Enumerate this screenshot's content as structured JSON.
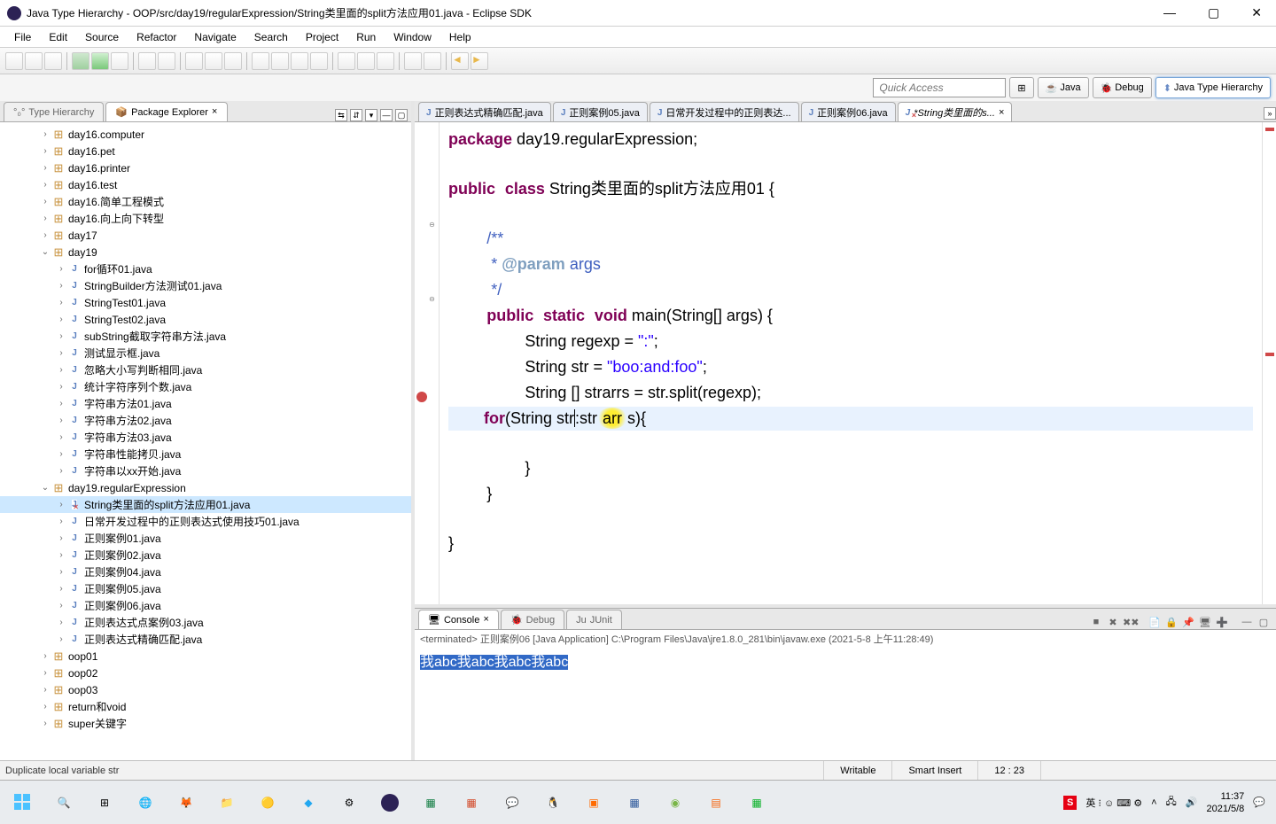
{
  "window": {
    "title": "Java Type Hierarchy - OOP/src/day19/regularExpression/String类里面的split方法应用01.java - Eclipse SDK"
  },
  "menu": [
    "File",
    "Edit",
    "Source",
    "Refactor",
    "Navigate",
    "Search",
    "Project",
    "Run",
    "Window",
    "Help"
  ],
  "quick_access_placeholder": "Quick Access",
  "perspectives": {
    "java": "Java",
    "debug": "Debug",
    "type_hierarchy": "Java Type Hierarchy"
  },
  "left_views": {
    "type_hierarchy": "Type Hierarchy",
    "package_explorer": "Package Explorer"
  },
  "tree": [
    {
      "l": 2,
      "t": "pkg",
      "exp": "›",
      "label": "day16.computer"
    },
    {
      "l": 2,
      "t": "pkg",
      "exp": "›",
      "label": "day16.pet"
    },
    {
      "l": 2,
      "t": "pkg",
      "exp": "›",
      "label": "day16.printer"
    },
    {
      "l": 2,
      "t": "pkg",
      "exp": "›",
      "label": "day16.test"
    },
    {
      "l": 2,
      "t": "pkg",
      "exp": "›",
      "label": "day16.简单工程模式"
    },
    {
      "l": 2,
      "t": "pkg",
      "exp": "›",
      "label": "day16.向上向下转型"
    },
    {
      "l": 2,
      "t": "pkg",
      "exp": "›",
      "label": "day17"
    },
    {
      "l": 2,
      "t": "pkg",
      "exp": "⌄",
      "label": "day19"
    },
    {
      "l": 3,
      "t": "j",
      "exp": "›",
      "label": "for循环01.java"
    },
    {
      "l": 3,
      "t": "j",
      "exp": "›",
      "label": "StringBuilder方法测试01.java"
    },
    {
      "l": 3,
      "t": "j",
      "exp": "›",
      "label": "StringTest01.java"
    },
    {
      "l": 3,
      "t": "j",
      "exp": "›",
      "label": "StringTest02.java"
    },
    {
      "l": 3,
      "t": "j",
      "exp": "›",
      "label": "subString截取字符串方法.java"
    },
    {
      "l": 3,
      "t": "j",
      "exp": "›",
      "label": "测试显示框.java"
    },
    {
      "l": 3,
      "t": "j",
      "exp": "›",
      "label": "忽略大小写判断相同.java"
    },
    {
      "l": 3,
      "t": "j",
      "exp": "›",
      "label": "统计字符序列个数.java"
    },
    {
      "l": 3,
      "t": "j",
      "exp": "›",
      "label": "字符串方法01.java"
    },
    {
      "l": 3,
      "t": "j",
      "exp": "›",
      "label": "字符串方法02.java"
    },
    {
      "l": 3,
      "t": "j",
      "exp": "›",
      "label": "字符串方法03.java"
    },
    {
      "l": 3,
      "t": "j",
      "exp": "›",
      "label": "字符串性能拷贝.java"
    },
    {
      "l": 3,
      "t": "j",
      "exp": "›",
      "label": "字符串以xx开始.java"
    },
    {
      "l": 2,
      "t": "pkg",
      "exp": "⌄",
      "label": "day19.regularExpression"
    },
    {
      "l": 3,
      "t": "jerr",
      "exp": "›",
      "label": "String类里面的split方法应用01.java",
      "sel": true
    },
    {
      "l": 3,
      "t": "j",
      "exp": "›",
      "label": "日常开发过程中的正则表达式使用技巧01.java"
    },
    {
      "l": 3,
      "t": "j",
      "exp": "›",
      "label": "正则案例01.java"
    },
    {
      "l": 3,
      "t": "j",
      "exp": "›",
      "label": "正则案例02.java"
    },
    {
      "l": 3,
      "t": "j",
      "exp": "›",
      "label": "正则案例04.java"
    },
    {
      "l": 3,
      "t": "j",
      "exp": "›",
      "label": "正则案例05.java"
    },
    {
      "l": 3,
      "t": "j",
      "exp": "›",
      "label": "正则案例06.java"
    },
    {
      "l": 3,
      "t": "j",
      "exp": "›",
      "label": "正则表达式点案例03.java"
    },
    {
      "l": 3,
      "t": "j",
      "exp": "›",
      "label": "正则表达式精确匹配.java"
    },
    {
      "l": 2,
      "t": "pkg",
      "exp": "›",
      "label": "oop01"
    },
    {
      "l": 2,
      "t": "pkg",
      "exp": "›",
      "label": "oop02"
    },
    {
      "l": 2,
      "t": "pkg",
      "exp": "›",
      "label": "oop03"
    },
    {
      "l": 2,
      "t": "pkg",
      "exp": "›",
      "label": "return和void"
    },
    {
      "l": 2,
      "t": "pkg",
      "exp": "›",
      "label": "super关键字"
    }
  ],
  "editor_tabs": [
    {
      "label": "正则表达式精确匹配.java",
      "active": false
    },
    {
      "label": "正则案例05.java",
      "active": false
    },
    {
      "label": "日常开发过程中的正则表达...",
      "active": false
    },
    {
      "label": "正则案例06.java",
      "active": false
    },
    {
      "label": "*String类里面的s...",
      "active": true
    }
  ],
  "code": {
    "l1_pkg": "package",
    "l1_rest": " day19.regularExpression;",
    "l3_pub": "public",
    "l3_cls": "class",
    "l3_rest": " String类里面的split方法应用01 {",
    "l5_c": "/**",
    "l6_c_pre": " * ",
    "l6_tag": "@param",
    "l6_c_post": " args",
    "l7_c": " */",
    "l8_pub": "public",
    "l8_stat": "static",
    "l8_void": "void",
    "l8_rest": " main(String[] args) {",
    "l9_a": "String regexp = ",
    "l9_s": "\":\"",
    "l9_b": ";",
    "l10_a": "String str = ",
    "l10_s": "\"boo:and:foo\"",
    "l10_b": ";",
    "l11": "String [] strarrs = str.split(regexp);",
    "l12_for": "for",
    "l12_a": "(String str",
    "l12_b": ":str",
    "l12_hl": "arr",
    "l12_c": "s){",
    "l14": "}",
    "l15": "}",
    "l17": "}"
  },
  "console_tabs": {
    "console": "Console",
    "debug": "Debug",
    "junit": "JUnit"
  },
  "console": {
    "header": "<terminated> 正则案例06 [Java Application] C:\\Program Files\\Java\\jre1.8.0_281\\bin\\javaw.exe (2021-5-8 上午11:28:49)",
    "output": "我abc我abc我abc我abc"
  },
  "status": {
    "message": "Duplicate local variable str",
    "writable": "Writable",
    "insert": "Smart Insert",
    "pos": "12 : 23"
  },
  "sysclock": {
    "time": "11:37",
    "date": "2021/5/8"
  },
  "ime_lang": "英"
}
